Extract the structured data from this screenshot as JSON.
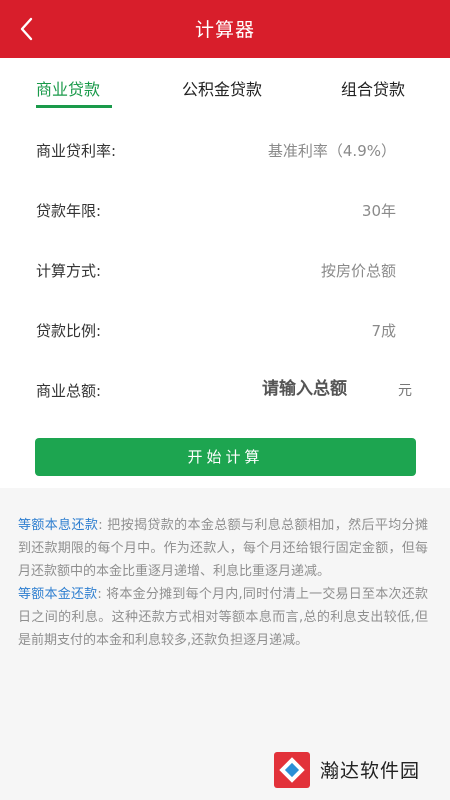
{
  "header": {
    "title": "计算器"
  },
  "tabs": [
    {
      "label": "商业贷款",
      "active": true
    },
    {
      "label": "公积金贷款",
      "active": false
    },
    {
      "label": "组合贷款",
      "active": false
    }
  ],
  "form": {
    "rate": {
      "label": "商业贷利率:",
      "value": "基准利率（4.9%）"
    },
    "term": {
      "label": "贷款年限:",
      "value": "30年"
    },
    "method": {
      "label": "计算方式:",
      "value": "按房价总额"
    },
    "ratio": {
      "label": "贷款比例:",
      "value": "7成"
    },
    "amount": {
      "label": "商业总额:",
      "placeholder": "请输入总额",
      "value": "",
      "unit": "元"
    }
  },
  "button": {
    "label": "开始计算"
  },
  "description": {
    "p1_term": "等额本息还款",
    "p1_text": ": 把按揭贷款的本金总额与利息总额相加，然后平均分摊到还款期限的每个月中。作为还款人，每个月还给银行固定金额，但每月还款额中的本金比重逐月递增、利息比重逐月递减。",
    "p2_term": "等额本金还款",
    "p2_text": ": 将本金分摊到每个月内,同时付清上一交易日至本次还款日之间的利息。这种还款方式相对等额本息而言,总的利息支出较低,但是前期支付的本金和利息较多,还款负担逐月递减。"
  },
  "watermark": {
    "text": "瀚达软件园"
  },
  "colors": {
    "header": "#d81e2b",
    "accent": "#1a9a4a",
    "button": "#1da550",
    "term": "#2f7fd0"
  }
}
